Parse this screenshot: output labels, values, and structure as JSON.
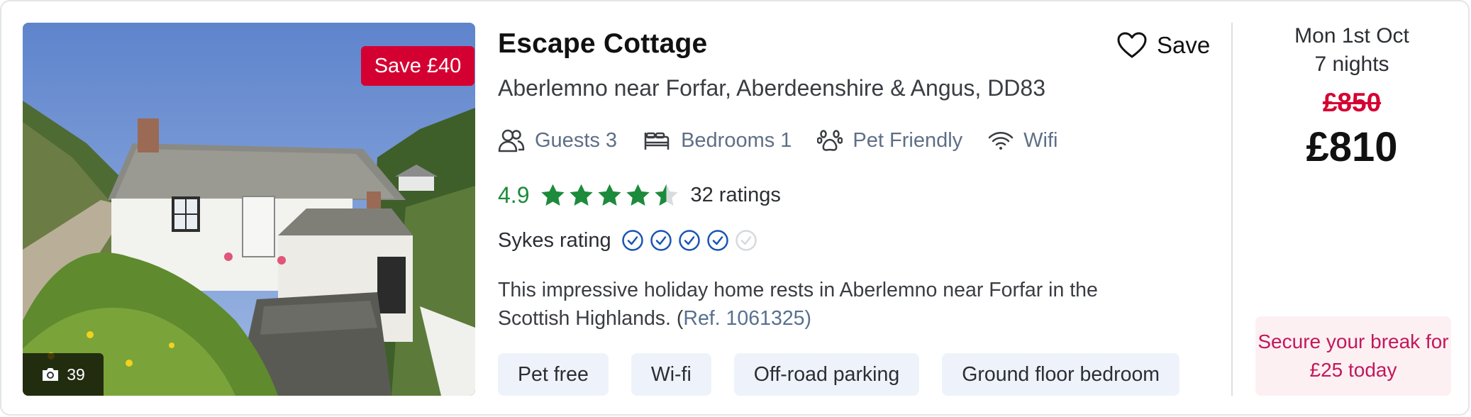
{
  "listing": {
    "title": "Escape Cottage",
    "location": "Aberlemno near Forfar, Aberdeenshire & Angus, DD83",
    "save_label": "Save",
    "image": {
      "save_badge": "Save £40",
      "photo_count": "39"
    },
    "features": [
      {
        "icon": "guests-icon",
        "label": "Guests 3"
      },
      {
        "icon": "bed-icon",
        "label": "Bedrooms 1"
      },
      {
        "icon": "paw-icon",
        "label": "Pet Friendly"
      },
      {
        "icon": "wifi-icon",
        "label": "Wifi"
      }
    ],
    "rating": {
      "score": "4.9",
      "stars": 4.5,
      "count_label": "32 ratings",
      "star_color": "#1c8b3b"
    },
    "sykes": {
      "label": "Sykes rating",
      "filled": 4,
      "total": 5,
      "color": "#1a55b3"
    },
    "description": {
      "text": "This impressive holiday home rests in Aberlemno near Forfar in the Scottish Highlands. (",
      "ref": "Ref. 1061325",
      "close": ")"
    },
    "tags": [
      "Pet free",
      "Wi-fi",
      "Off-road parking",
      "Ground floor bedroom"
    ]
  },
  "pricing": {
    "date": "Mon 1st Oct",
    "nights": "7 nights",
    "old_price": "£850",
    "new_price": "£810",
    "deposit": "Secure your break for £25 today",
    "accent_color": "#d50032",
    "deposit_color": "#c2185b"
  }
}
